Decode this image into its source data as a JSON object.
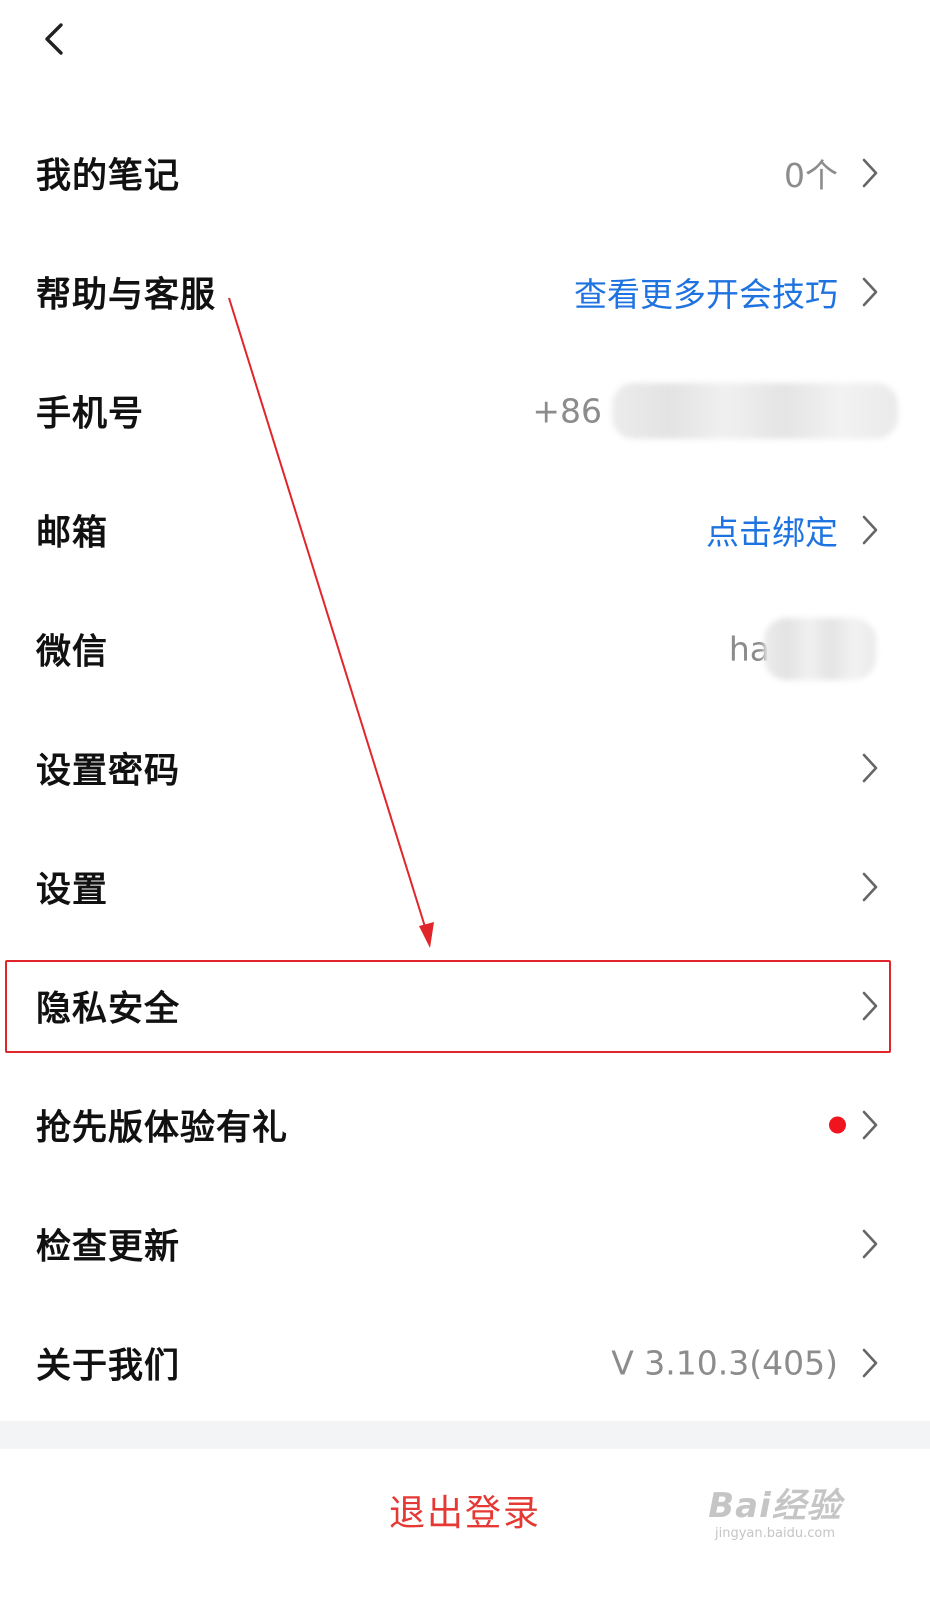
{
  "rows": [
    {
      "label": "我的笔记",
      "value": "0个"
    },
    {
      "label": "帮助与客服",
      "value": "查看更多开会技巧"
    },
    {
      "label": "手机号",
      "value": "+86"
    },
    {
      "label": "邮箱",
      "value": "点击绑定"
    },
    {
      "label": "微信",
      "value": "ha"
    },
    {
      "label": "设置密码"
    },
    {
      "label": "设置"
    },
    {
      "label": "隐私安全"
    },
    {
      "label": "抢先版体验有礼"
    },
    {
      "label": "检查更新"
    },
    {
      "label": "关于我们",
      "value": "V 3.10.3(405)"
    }
  ],
  "logout": {
    "label": "退出登录"
  },
  "watermark": {
    "main": "Bai经验",
    "sub": "jingyan.baidu.com"
  },
  "colors": {
    "accent_blue": "#1f73e0",
    "muted_gray": "#8c8c8c",
    "logout_red": "#e53935",
    "badge_red": "#f0141e",
    "annotation_red": "#e0262a"
  }
}
